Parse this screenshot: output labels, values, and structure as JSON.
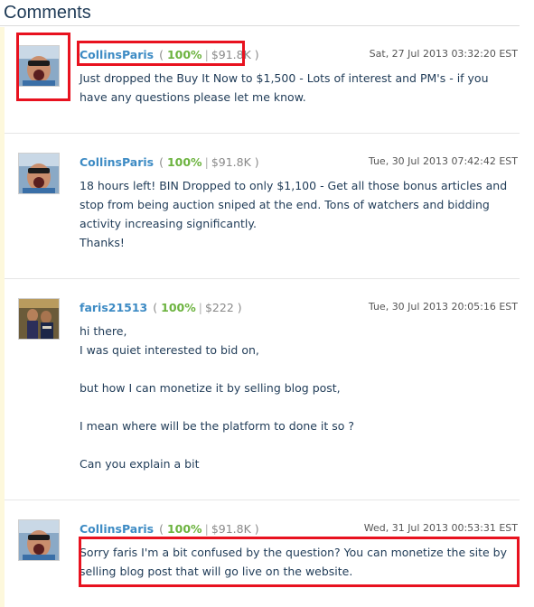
{
  "section_title": "Comments",
  "comments": [
    {
      "user": "CollinsParis",
      "rating": "100%",
      "amount": "$91.8K",
      "date": "Sat, 27 Jul 2013 03:32:20 EST",
      "lines": [
        "Just dropped the Buy It Now to $1,500 - Lots of interest and PM's - if you have any questions please let me know."
      ]
    },
    {
      "user": "CollinsParis",
      "rating": "100%",
      "amount": "$91.8K",
      "date": "Tue, 30 Jul 2013 07:42:42 EST",
      "lines": [
        "18 hours left! BIN Dropped to only $1,100 - Get all those bonus articles and stop from being auction sniped at the end. Tons of watchers and bidding activity increasing significantly.",
        "Thanks!"
      ]
    },
    {
      "user": "faris21513",
      "rating": "100%",
      "amount": "$222",
      "date": "Tue, 30 Jul 2013 20:05:16 EST",
      "lines": [
        "hi there,",
        "I was quiet interested to bid on,",
        "",
        "but how I can monetize it by selling blog post,",
        "",
        "I mean where will be the platform to done it so ?",
        "",
        "Can you explain a bit"
      ]
    },
    {
      "user": "CollinsParis",
      "rating": "100%",
      "amount": "$91.8K",
      "date": "Wed, 31 Jul 2013 00:53:31 EST",
      "lines": [
        "Sorry faris I'm a bit confused by the question? You can monetize the site by selling blog post that will go live on the website."
      ]
    }
  ]
}
